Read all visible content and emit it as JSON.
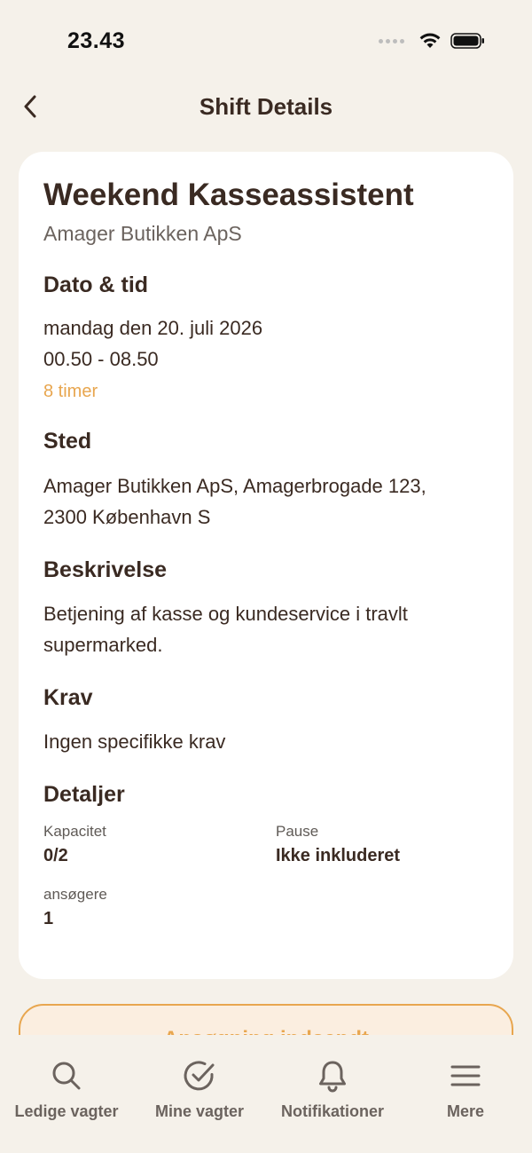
{
  "status_bar": {
    "time": "23.43",
    "icons": [
      "signal-dots-icon",
      "wifi-icon",
      "battery-icon"
    ]
  },
  "header": {
    "title": "Shift Details",
    "back_icon": "chevron-left-icon"
  },
  "shift": {
    "title": "Weekend Kasseassistent",
    "company": "Amager Butikken ApS",
    "date_time": {
      "heading": "Dato & tid",
      "date": "mandag den 20. juli 2026",
      "time": "00.50 - 08.50",
      "duration": "8 timer"
    },
    "location": {
      "heading": "Sted",
      "line1": "Amager Butikken ApS, Amagerbrogade 123,",
      "line2": "2300 København S"
    },
    "description": {
      "heading": "Beskrivelse",
      "line1": "Betjening af kasse og kundeservice i travlt",
      "line2": "supermarked."
    },
    "requirements": {
      "heading": "Krav",
      "text": "Ingen specifikke krav"
    },
    "details": {
      "heading": "Detaljer",
      "capacity_label": "Kapacitet",
      "capacity_value": "0/2",
      "break_label": "Pause",
      "break_value": "Ikke inkluderet",
      "applicants_label": "ansøgere",
      "applicants_value": "1"
    }
  },
  "apply_button": {
    "label": "Ansøgning indsendt"
  },
  "colors": {
    "background": "#f5f1ea",
    "accent": "#e8a64f",
    "text_primary": "#3a2a22",
    "text_secondary": "#6b635e"
  },
  "bottom_nav": [
    {
      "label": "Ledige vagter",
      "icon": "search-icon"
    },
    {
      "label": "Mine vagter",
      "icon": "check-circle-icon"
    },
    {
      "label": "Notifikationer",
      "icon": "bell-icon"
    },
    {
      "label": "Mere",
      "icon": "menu-icon"
    }
  ]
}
